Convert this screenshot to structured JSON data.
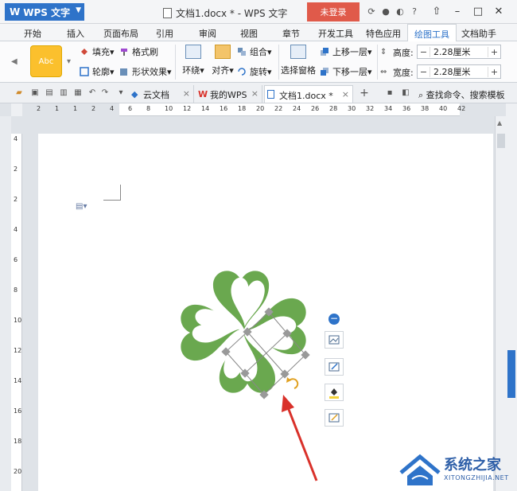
{
  "titlebar": {
    "app_label": "WPS 文字",
    "doc_title": "文档1.docx * - WPS 文字",
    "login_label": "未登录"
  },
  "menu": {
    "tabs": [
      "开始",
      "插入",
      "页面布局",
      "引用",
      "审阅",
      "视图",
      "章节",
      "开发工具",
      "特色应用",
      "绘图工具",
      "文档助手"
    ],
    "active_tab": "绘图工具"
  },
  "ribbon": {
    "style_swatch_label": "Abc",
    "fill_label": "填充",
    "format_brush_label": "格式刷",
    "outline_label": "轮廓",
    "shape_effect_label": "形状效果",
    "wrap_label": "环绕",
    "align_label": "对齐",
    "group_label": "组合",
    "rotate_label": "旋转",
    "selection_pane_label": "选择窗格",
    "bring_forward_label": "上移一层",
    "send_backward_label": "下移一层",
    "height_label": "高度:",
    "height_value": "2.28厘米",
    "width_label": "宽度:",
    "width_value": "2.28厘米"
  },
  "doc_tabs": {
    "tabs": [
      {
        "label": "云文档"
      },
      {
        "label": "我的WPS"
      },
      {
        "label": "文档1.docx *"
      }
    ],
    "search_label": "查找命令、搜索模板"
  },
  "ruler": {
    "h_numbers": [
      "2",
      "1",
      "1",
      "2",
      "4",
      "6",
      "8",
      "10",
      "12",
      "14",
      "16",
      "18",
      "20",
      "22",
      "24",
      "26",
      "28",
      "30",
      "32",
      "34",
      "36",
      "38",
      "40",
      "42"
    ],
    "v_numbers": [
      "4",
      "2",
      "2",
      "4",
      "6",
      "8",
      "10",
      "12",
      "14",
      "16",
      "18",
      "20"
    ]
  },
  "watermark": {
    "name": "系统之家",
    "url": "XITONGZHIJIA.NET"
  },
  "colors": {
    "accent": "#2e73c9",
    "leaf_green": "#6aa84f",
    "login_red": "#e05a4a",
    "swatch_yellow": "#fbc02d",
    "arrow_red": "#d9312a"
  }
}
